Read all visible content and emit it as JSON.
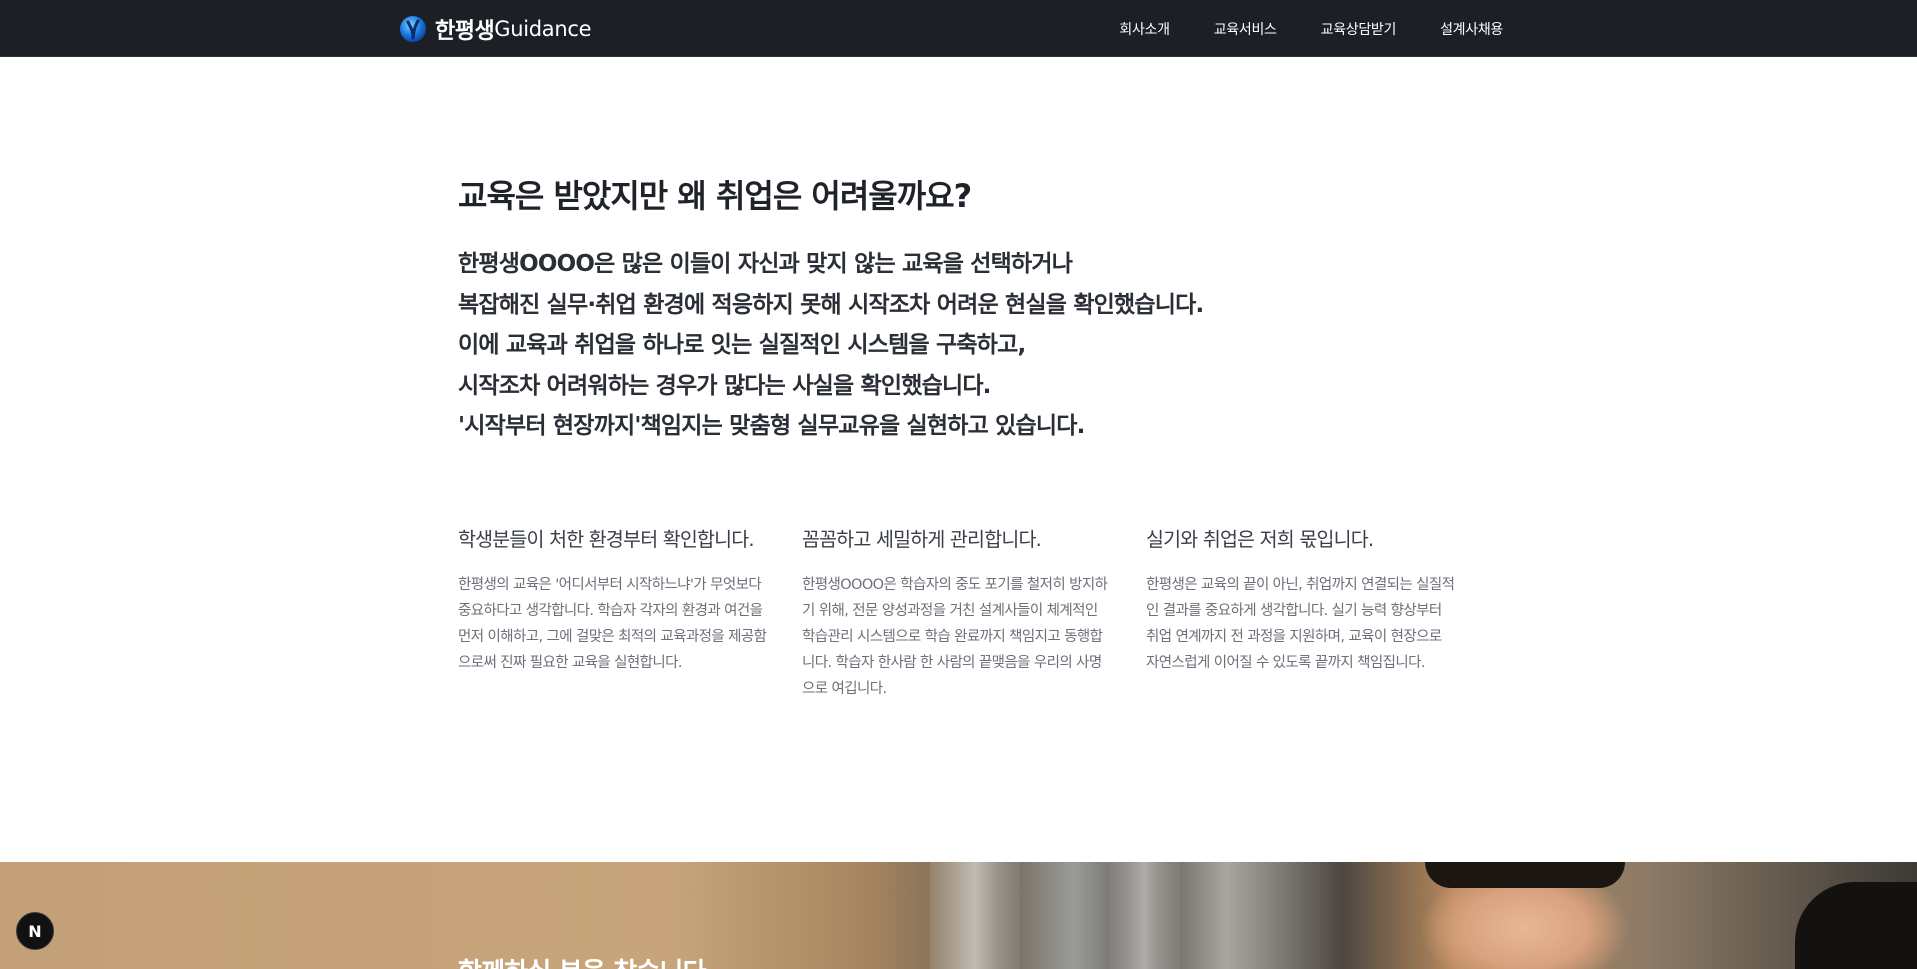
{
  "header": {
    "logo_ko": "한평생",
    "logo_en": "Guidance",
    "logo_icon": "globe-logo-icon",
    "nav": [
      {
        "label": "회사소개"
      },
      {
        "label": "교육서비스"
      },
      {
        "label": "교육상담받기"
      },
      {
        "label": "설계사채용"
      }
    ]
  },
  "intro": {
    "headline": "교육은 받았지만 왜 취업은 어려울까요?",
    "lines": [
      "한평생OOOO은 많은 이들이 자신과 맞지 않는 교육을 선택하거나",
      "복잡해진 실무·취업 환경에 적응하지 못해 시작조차 어려운 현실을 확인했습니다.",
      "이에 교육과 취업을 하나로 잇는 실질적인 시스템을 구축하고,",
      "시작조차 어려워하는 경우가 많다는 사실을 확인했습니다.",
      "'시작부터 현장까지'책임지는 맞춤형 실무교유을 실현하고 있습니다."
    ]
  },
  "features": [
    {
      "title": "학생분들이 처한 환경부터 확인합니다.",
      "body": "한평생의 교육은 '어디서부터 시작하느냐'가 무엇보다 중요하다고 생각합니다. 학습자 각자의 환경과 여건을 먼저 이해하고, 그에 걸맞은 최적의 교육과정을 제공함으로써 진짜 필요한 교육을 실현합니다."
    },
    {
      "title": "꼼꼼하고 세밀하게 관리합니다.",
      "body": "한평생OOOO은 학습자의 중도 포기를 철저히 방지하기 위해, 전문 양성과정을 거친 설계사들이 체계적인 학습관리 시스템으로 학습 완료까지 책임지고 동행합니다. 학습자 한사람 한 사람의 끝맺음을 우리의 사명으로 여깁니다."
    },
    {
      "title": "실기와 취업은 저희 몫입니다.",
      "body": "한평생은 교육의 끝이 아닌, 취업까지 연결되는 실질적인 결과를 중요하게 생각합니다. 실기 능력 향상부터 취업 연계까지 전 과정을 지원하며, 교육이 현장으로 자연스럽게 이어질 수 있도록 끝까지 책임집니다."
    }
  ],
  "banner": {
    "text": "함께하실 분을 찾습니다"
  },
  "badge": {
    "label": "N",
    "icon": "nextjs-badge-icon"
  },
  "colors": {
    "header_bg": "#1c1f26",
    "text_dark": "#1f2329",
    "text_muted": "#6b7079"
  }
}
